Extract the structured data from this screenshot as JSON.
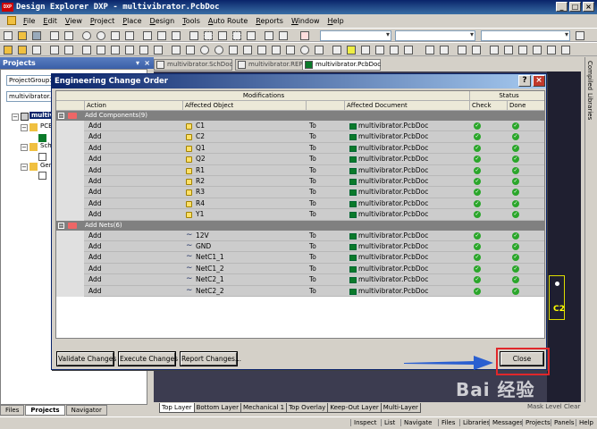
{
  "app": {
    "title": "Design Explorer DXP - multivibrator.PcbDoc"
  },
  "menu": [
    "File",
    "Edit",
    "View",
    "Project",
    "Place",
    "Design",
    "Tools",
    "Auto Route",
    "Reports",
    "Window",
    "Help"
  ],
  "projects_panel": {
    "header": "Projects",
    "workspace_field": "ProjectGroup1.",
    "project_field": "multivibrator.Pr",
    "tree": [
      "multivi",
      "PCB",
      "Sch",
      "Gen"
    ],
    "tabs": [
      "Files",
      "Projects",
      "Navigator"
    ]
  },
  "doc_tabs": [
    "multivibrator.SchDoc",
    "multivibrator.REP",
    "multivibrator.PcbDoc"
  ],
  "right_rail": [
    "Compiled",
    "Libraries"
  ],
  "canvas": {
    "component_label": "C2"
  },
  "dialog": {
    "title": "Engineering Change Order",
    "modifications_header": "Modifications",
    "status_header": "Status",
    "columns": {
      "action": "Action",
      "affected_object": "Affected Object",
      "affected_document": "Affected Document",
      "check": "Check",
      "done": "Done"
    },
    "groups": [
      {
        "label": "Add Components(9)",
        "rows": [
          {
            "action": "Add",
            "object": "C1",
            "to": "To",
            "document": "multivibrator.PcbDoc"
          },
          {
            "action": "Add",
            "object": "C2",
            "to": "To",
            "document": "multivibrator.PcbDoc"
          },
          {
            "action": "Add",
            "object": "Q1",
            "to": "To",
            "document": "multivibrator.PcbDoc"
          },
          {
            "action": "Add",
            "object": "Q2",
            "to": "To",
            "document": "multivibrator.PcbDoc"
          },
          {
            "action": "Add",
            "object": "R1",
            "to": "To",
            "document": "multivibrator.PcbDoc"
          },
          {
            "action": "Add",
            "object": "R2",
            "to": "To",
            "document": "multivibrator.PcbDoc"
          },
          {
            "action": "Add",
            "object": "R3",
            "to": "To",
            "document": "multivibrator.PcbDoc"
          },
          {
            "action": "Add",
            "object": "R4",
            "to": "To",
            "document": "multivibrator.PcbDoc"
          },
          {
            "action": "Add",
            "object": "Y1",
            "to": "To",
            "document": "multivibrator.PcbDoc"
          }
        ]
      },
      {
        "label": "Add Nets(6)",
        "rows": [
          {
            "action": "Add",
            "object": "12V",
            "to": "To",
            "document": "multivibrator.PcbDoc"
          },
          {
            "action": "Add",
            "object": "GND",
            "to": "To",
            "document": "multivibrator.PcbDoc"
          },
          {
            "action": "Add",
            "object": "NetC1_1",
            "to": "To",
            "document": "multivibrator.PcbDoc"
          },
          {
            "action": "Add",
            "object": "NetC1_2",
            "to": "To",
            "document": "multivibrator.PcbDoc"
          },
          {
            "action": "Add",
            "object": "NetC2_1",
            "to": "To",
            "document": "multivibrator.PcbDoc"
          },
          {
            "action": "Add",
            "object": "NetC2_2",
            "to": "To",
            "document": "multivibrator.PcbDoc"
          }
        ]
      }
    ],
    "buttons": {
      "validate": "Validate Changes",
      "execute": "Execute Changes",
      "report": "Report Changes...",
      "close": "Close"
    }
  },
  "layer_tabs": [
    "Top Layer",
    "Bottom Layer",
    "Mechanical 1",
    "Top Overlay",
    "Keep-Out Layer",
    "Multi-Layer"
  ],
  "layer_right": "Mask Level  Clear",
  "status_bar": [
    "Inspect",
    "List",
    "Navigate",
    "Files",
    "Libraries",
    "Messages",
    "Projects",
    "Panels",
    "Help"
  ],
  "watermark": "Bai 经验",
  "colors": {
    "titlebar": "#0a246a",
    "highlight_box": "#e0272a",
    "arrow": "#2a5fd0",
    "check_ok": "#2aa62a"
  }
}
